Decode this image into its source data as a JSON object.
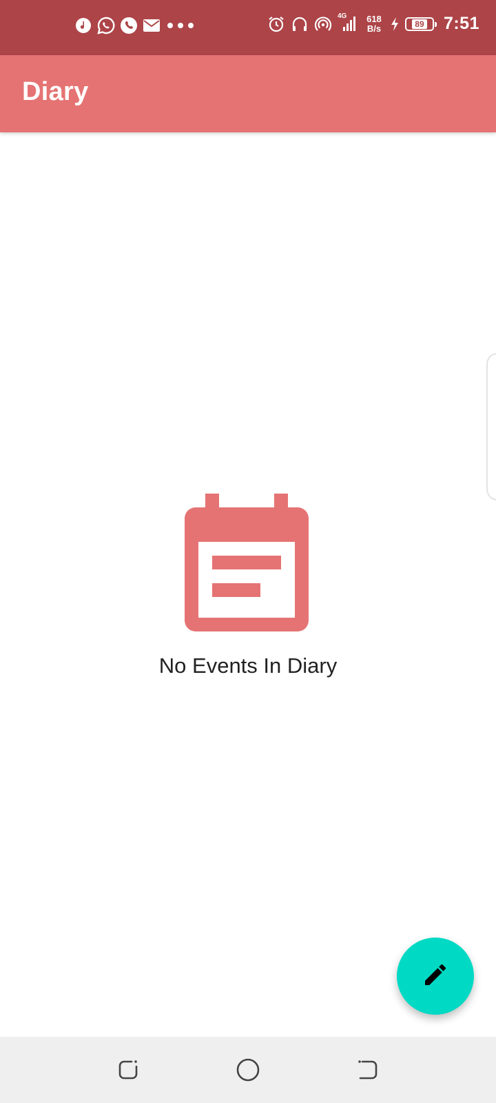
{
  "status_bar": {
    "left_icons": [
      "music-note-icon",
      "whatsapp-icon",
      "phone-icon",
      "mail-icon",
      "more-dots-icon"
    ],
    "right_icons": [
      "alarm-icon",
      "headset-icon",
      "hotspot-icon",
      "signal-icon"
    ],
    "network_type": "4G",
    "net_speed_value": "618",
    "net_speed_unit": "B/s",
    "battery": "89",
    "time": "7:51"
  },
  "app_bar": {
    "title": "Diary"
  },
  "empty_state": {
    "icon": "calendar-event-icon",
    "message": "No Events In Diary"
  },
  "fab": {
    "icon": "pencil-icon"
  },
  "nav_bar": {
    "buttons": [
      "recents",
      "home",
      "back"
    ]
  },
  "colors": {
    "status_bar": "#ad4448",
    "primary": "#e57373",
    "accent": "#00d9c4",
    "nav_bar": "#efefef"
  }
}
